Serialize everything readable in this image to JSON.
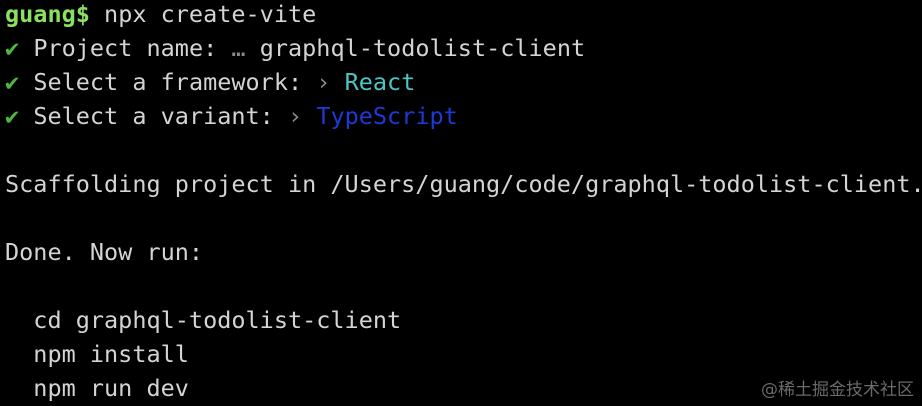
{
  "prompt": "guang$",
  "command": "npx create-vite",
  "check_icon": "✔",
  "answers": [
    {
      "label": "Project name:",
      "sep": "…",
      "value": "graphql-todolist-client"
    },
    {
      "label": "Select a framework:",
      "sep": "›",
      "value": "React"
    },
    {
      "label": "Select a variant:",
      "sep": "›",
      "value": "TypeScript"
    }
  ],
  "scaffolding": "Scaffolding project in /Users/guang/code/graphql-todolist-client...",
  "done": "Done. Now run:",
  "next_steps": [
    "cd graphql-todolist-client",
    "npm install",
    "npm run dev"
  ],
  "colors": {
    "prompt": "#8ae05f",
    "check": "#4fb83c",
    "react": "#4cc6c4",
    "typescript": "#1d39d6"
  },
  "watermark": "@稀土掘金技术社区"
}
